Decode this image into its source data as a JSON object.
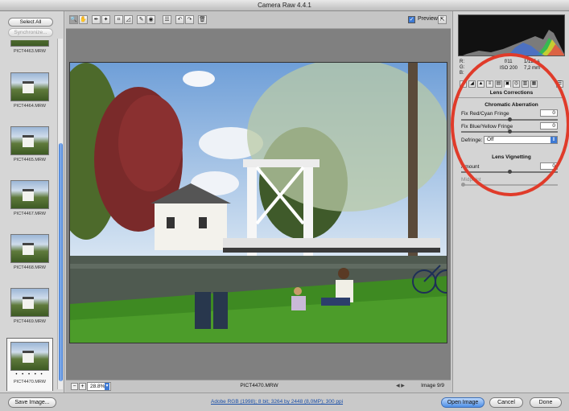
{
  "window": {
    "title": "Camera Raw 4.4.1"
  },
  "filmstrip": {
    "select_all_label": "Select All",
    "synchronize_label": "Synchronize...",
    "thumbs": [
      {
        "label": "PICT4463.MRW"
      },
      {
        "label": "PICT4464.MRW"
      },
      {
        "label": "PICT4465.MRW"
      },
      {
        "label": "PICT4467.MRW"
      },
      {
        "label": "PICT4468.MRW"
      },
      {
        "label": "PICT4469.MRW"
      }
    ],
    "selected": {
      "label": "PICT4470.MRW",
      "rating": "• • • • •"
    }
  },
  "toolbar": {
    "tools": [
      {
        "icon": "zoom-icon",
        "glyph": "🔍"
      },
      {
        "icon": "hand-icon",
        "glyph": "✋"
      },
      {
        "icon": "white-balance-icon",
        "glyph": "✒"
      },
      {
        "icon": "color-sampler-icon",
        "glyph": "✦"
      },
      {
        "icon": "crop-icon",
        "glyph": "⌗"
      },
      {
        "icon": "straighten-icon",
        "glyph": "◿"
      },
      {
        "icon": "retouch-icon",
        "glyph": "✎"
      },
      {
        "icon": "red-eye-icon",
        "glyph": "◉"
      },
      {
        "icon": "preferences-icon",
        "glyph": "☰"
      },
      {
        "icon": "rotate-left-icon",
        "glyph": "↶"
      },
      {
        "icon": "rotate-right-icon",
        "glyph": "↷"
      },
      {
        "icon": "trash-icon",
        "glyph": "🗑"
      }
    ],
    "preview_label": "Preview"
  },
  "canvas_bar": {
    "zoom": "28.8%",
    "filename": "PICT4470.MRW",
    "image_count": "Image 9/9"
  },
  "exif": {
    "r": "R:",
    "g": "G:",
    "b": "B:",
    "aperture": "f/11",
    "shutter": "1/125 s",
    "iso": "ISO 200",
    "focal": "7,2 mm"
  },
  "panel": {
    "title": "Lens Corrections",
    "ca_title": "Chromatic Aberration",
    "fix_red_cyan_label": "Fix Red/Cyan Fringe",
    "fix_red_cyan_value": "0",
    "fix_blue_yellow_label": "Fix Blue/Yellow Fringe",
    "fix_blue_yellow_value": "0",
    "defringe_label": "Defringe:",
    "defringe_value": "Off",
    "vignetting_title": "Lens Vignetting",
    "amount_label": "Amount",
    "amount_value": "0",
    "midpoint_label": "Midpoint"
  },
  "footer": {
    "save_label": "Save Image...",
    "workflow_text": "Adobe RGB (1998); 8 bit; 3264 by 2448 (8,0MP); 300 ppi",
    "open_label": "Open Image",
    "cancel_label": "Cancel",
    "done_label": "Done"
  },
  "colors": {
    "accent": "#3d79d3",
    "annotation": "#e03b2a"
  }
}
